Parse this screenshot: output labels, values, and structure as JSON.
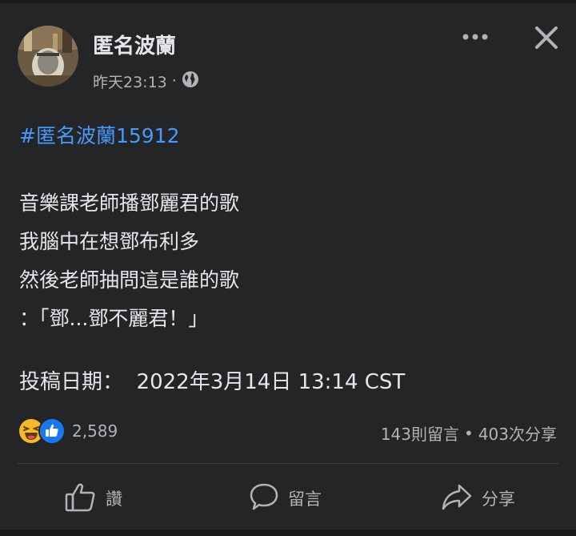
{
  "post": {
    "author": "匿名波蘭",
    "timestamp": "昨天23:13",
    "separator": "·",
    "audience_icon": "globe-icon",
    "hashtag": "#匿名波蘭15912",
    "lines": [
      "音樂課老師播鄧麗君的歌",
      "我腦中在想鄧布利多",
      "然後老師抽問這是誰的歌",
      "：「鄧...鄧不麗君！」"
    ],
    "date_line": "投稿日期：  2022年3月14日 13:14 CST"
  },
  "engagement": {
    "reaction_icons": [
      "haha-icon",
      "like-icon"
    ],
    "reaction_count": "2,589",
    "comments": "143則留言",
    "dot": "•",
    "shares": "403次分享"
  },
  "actions": {
    "like": "讚",
    "comment": "留言",
    "share": "分享"
  },
  "colors": {
    "background": "#242526",
    "text": "#e4e6eb",
    "muted": "#b0b3b8",
    "link": "#4599ff",
    "like_blue": "#1877f2",
    "haha_yellow": "#f7b928"
  }
}
